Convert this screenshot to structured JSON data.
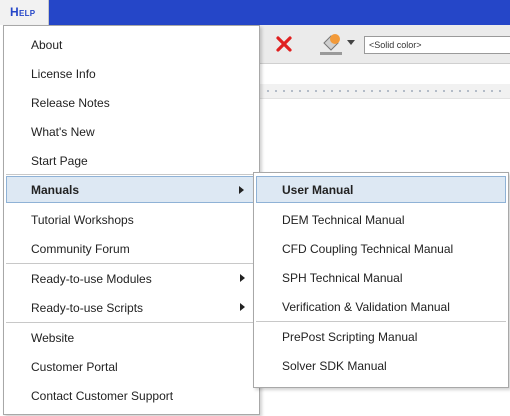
{
  "menubar": {
    "help_label": "Help"
  },
  "toolbar": {
    "fill_color_placeholder": "<Solid color>",
    "delete_icon": "close-x",
    "paint_icon": "paint-bucket"
  },
  "help_menu": {
    "items": [
      {
        "label": "About"
      },
      {
        "label": "License Info"
      },
      {
        "label": "Release Notes"
      },
      {
        "label": "What's New"
      },
      {
        "label": "Start Page"
      },
      {
        "label": "Manuals",
        "has_submenu": true,
        "active": true
      },
      {
        "label": "Tutorial Workshops"
      },
      {
        "label": "Community Forum"
      },
      {
        "label": "Ready-to-use Modules",
        "has_submenu": true
      },
      {
        "label": "Ready-to-use Scripts",
        "has_submenu": true
      },
      {
        "label": "Website"
      },
      {
        "label": "Customer Portal"
      },
      {
        "label": "Contact Customer Support"
      }
    ]
  },
  "manuals_submenu": {
    "items": [
      {
        "label": "User Manual",
        "active": true
      },
      {
        "label": "DEM Technical Manual"
      },
      {
        "label": "CFD Coupling Technical Manual"
      },
      {
        "label": "SPH Technical Manual"
      },
      {
        "label": "Verification & Validation Manual"
      },
      {
        "label": "PrePost Scripting Manual"
      },
      {
        "label": "Solver SDK Manual"
      }
    ]
  },
  "colors": {
    "menubar_bg": "#2546c8",
    "highlight_bg": "#dde8f3",
    "highlight_border": "#8fb2d6",
    "delete_red": "#e02020",
    "paint_orange": "#f29a3a"
  }
}
